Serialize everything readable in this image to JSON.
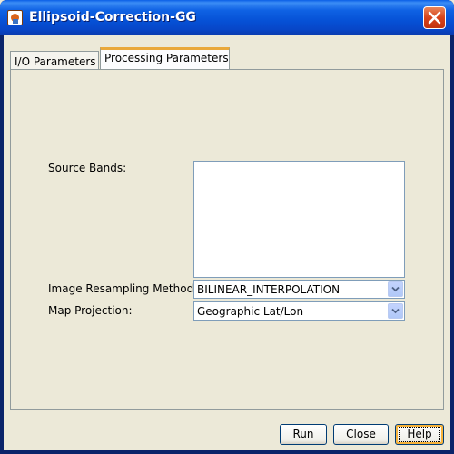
{
  "window": {
    "title": "Ellipsoid-Correction-GG"
  },
  "tabs": [
    {
      "label": "I/O Parameters",
      "selected": false
    },
    {
      "label": "Processing Parameters",
      "selected": true
    }
  ],
  "form": {
    "source_bands_label": "Source Bands:",
    "source_bands_items": [],
    "resampling_label": "Image Resampling Method:",
    "resampling_value": "BILINEAR_INTERPOLATION",
    "projection_label": "Map Projection:",
    "projection_value": "Geographic Lat/Lon"
  },
  "buttons": {
    "run": "Run",
    "close": "Close",
    "help": "Help"
  },
  "icons": {
    "app": "java-cup-icon",
    "close": "close-x-icon",
    "dropdown": "chevron-down-icon"
  },
  "colors": {
    "titlebar": "#0651d6",
    "close_button": "#d6431b",
    "tab_highlight": "#e9a83a",
    "background": "#ece9d8"
  }
}
